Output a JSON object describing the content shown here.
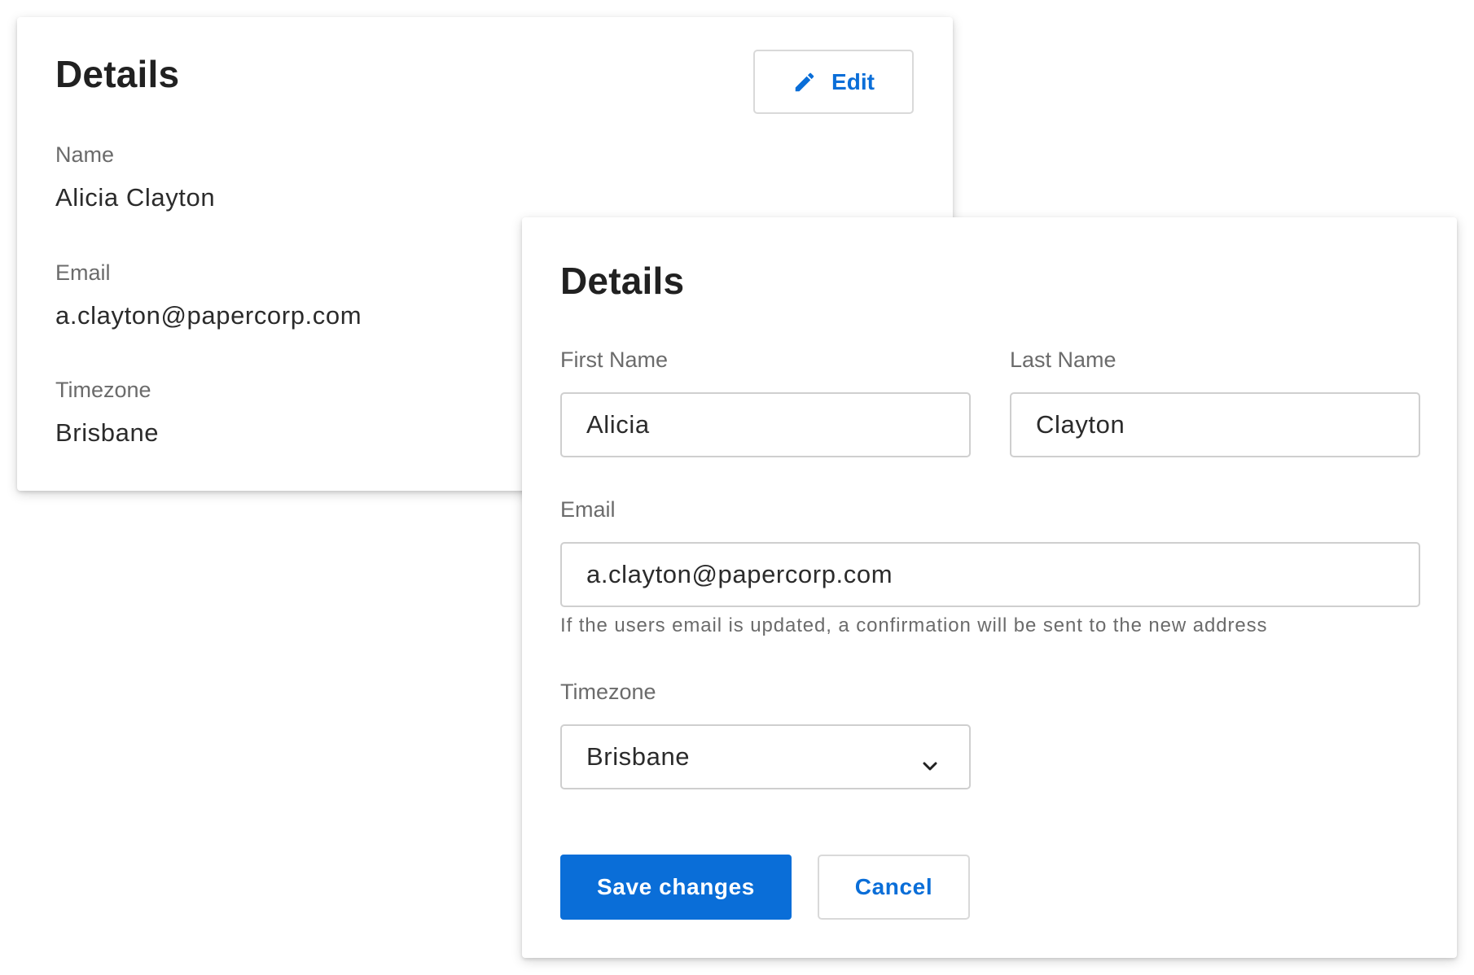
{
  "view_card": {
    "title": "Details",
    "edit_label": "Edit",
    "name_label": "Name",
    "name_value": "Alicia Clayton",
    "email_label": "Email",
    "email_value": "a.clayton@papercorp.com",
    "timezone_label": "Timezone",
    "timezone_value": "Brisbane"
  },
  "edit_card": {
    "title": "Details",
    "first_name_label": "First Name",
    "first_name_value": "Alicia",
    "last_name_label": "Last Name",
    "last_name_value": "Clayton",
    "email_label": "Email",
    "email_value": "a.clayton@papercorp.com",
    "email_help": "If the users email is updated, a confirmation will be sent to the new address",
    "timezone_label": "Timezone",
    "timezone_value": "Brisbane",
    "save_label": "Save changes",
    "cancel_label": "Cancel"
  },
  "icons": {
    "edit": "pencil-icon",
    "select": "chevron-down-icon"
  },
  "colors": {
    "accent": "#0a6ed8",
    "border": "#cfcfcf",
    "label": "#6b6b6b",
    "text": "#212121"
  }
}
